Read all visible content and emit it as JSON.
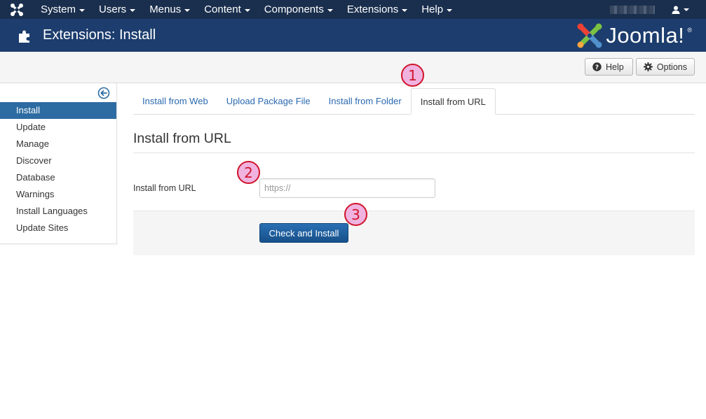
{
  "navbar": {
    "menu": [
      {
        "label": "System"
      },
      {
        "label": "Users"
      },
      {
        "label": "Menus"
      },
      {
        "label": "Content"
      },
      {
        "label": "Components"
      },
      {
        "label": "Extensions"
      },
      {
        "label": "Help"
      }
    ],
    "logo_icon": "joomla-logo-icon",
    "user_icon": "user-icon"
  },
  "header": {
    "title": "Extensions: Install",
    "icon": "puzzle-icon",
    "brand": "Joomla!",
    "brand_mark": "®"
  },
  "toolbar": {
    "help_label": "Help",
    "options_label": "Options"
  },
  "sidebar": {
    "items": [
      {
        "label": "Install",
        "active": true
      },
      {
        "label": "Update"
      },
      {
        "label": "Manage"
      },
      {
        "label": "Discover"
      },
      {
        "label": "Database"
      },
      {
        "label": "Warnings"
      },
      {
        "label": "Install Languages"
      },
      {
        "label": "Update Sites"
      }
    ]
  },
  "tabs": [
    {
      "label": "Install from Web"
    },
    {
      "label": "Upload Package File"
    },
    {
      "label": "Install from Folder"
    },
    {
      "label": "Install from URL",
      "active": true
    }
  ],
  "main": {
    "heading": "Install from URL",
    "field_label": "Install from URL",
    "url_placeholder": "https://",
    "url_value": "",
    "submit_label": "Check and Install"
  },
  "annotations": [
    "1",
    "2",
    "3"
  ],
  "colors": {
    "navbar_bg": "#1a2f4e",
    "header_bg": "#1c3d6d",
    "accent": "#2d6ca2",
    "annotation_border": "#d0142a",
    "annotation_fill": "#f0b3e0"
  }
}
